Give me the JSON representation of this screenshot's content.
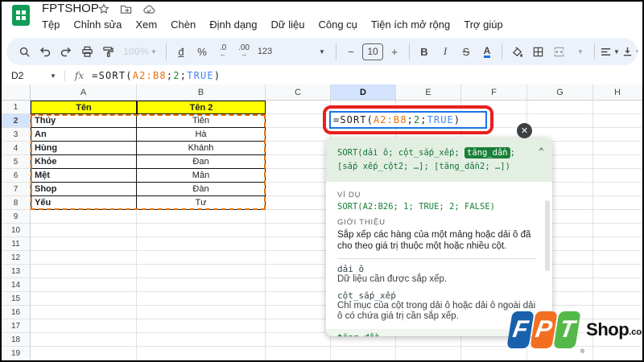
{
  "window": {
    "title": "FPTSHOP"
  },
  "menu_bar": {
    "items": [
      "Tệp",
      "Chỉnh sửa",
      "Xem",
      "Chèn",
      "Định dạng",
      "Dữ liệu",
      "Công cụ",
      "Tiện ích mở rộng",
      "Trợ giúp"
    ]
  },
  "toolbar": {
    "zoom_value": "100%",
    "currency_label": "đ",
    "percent_label": "%",
    "decimal_decrease_label": ".0",
    "decimal_increase_label": ".00",
    "number_format_label": "123",
    "font_size_value": "10",
    "minus_label": "−",
    "plus_label": "+",
    "bold_label": "B",
    "italic_label": "I",
    "strikethrough_label": "S",
    "text_color_label": "A"
  },
  "formula_bar": {
    "cell_reference": "D2",
    "fx_label": "fx",
    "formula_parts": [
      {
        "text": "=SORT(",
        "color": "#202124"
      },
      {
        "text": "A2:B8",
        "color": "#e8710a"
      },
      {
        "text": ";",
        "color": "#202124"
      },
      {
        "text": "2",
        "color": "#188038"
      },
      {
        "text": ";",
        "color": "#202124"
      },
      {
        "text": "TRUE",
        "color": "#4285f4"
      },
      {
        "text": ")",
        "color": "#202124"
      }
    ]
  },
  "grid": {
    "column_headers": [
      "A",
      "B",
      "C",
      "D",
      "E",
      "F",
      "G",
      "H"
    ],
    "row_headers": [
      "1",
      "2",
      "3",
      "4",
      "5",
      "6",
      "7",
      "8",
      "9",
      "10",
      "11",
      "12",
      "13",
      "14",
      "15",
      "16",
      "17",
      "18",
      "19"
    ],
    "selected_column": "D",
    "selected_row": "2",
    "table": {
      "header_row": [
        "Tên",
        "Tên 2"
      ],
      "data_rows": [
        [
          "Thúy",
          "Tiên"
        ],
        [
          "An",
          "Hà"
        ],
        [
          "Hùng",
          "Khánh"
        ],
        [
          "Khỏe",
          "Đan"
        ],
        [
          "Mệt",
          "Mân"
        ],
        [
          "Shop",
          "Đàn"
        ],
        [
          "Yếu",
          "Tư"
        ]
      ]
    },
    "active_cell_formula_parts": [
      {
        "text": "=SORT(",
        "color": "#202124"
      },
      {
        "text": "A2:B8",
        "color": "#e8710a"
      },
      {
        "text": ";",
        "color": "#202124"
      },
      {
        "text": "2",
        "color": "#188038"
      },
      {
        "text": ";",
        "color": "#202124"
      },
      {
        "text": "TRUE",
        "color": "#4285f4"
      },
      {
        "text": ")",
        "color": "#202124"
      }
    ]
  },
  "formula_help": {
    "close_label": "✕",
    "collapse_label": "⌃",
    "syntax_prefix": "SORT(dải ô; cột_sắp_xếp; ",
    "syntax_highlight": "tăng_dần",
    "syntax_suffix": ";",
    "syntax_line2": "[sắp xếp_cột2; …]; [tăng_dần2; …])",
    "example_label": "VÍ DỤ",
    "example_code": "SORT(A2:B26; 1; TRUE; 2; FALSE)",
    "about_label": "GIỚI THIỆU",
    "about_text": "Sắp xếp các hàng của một mảng hoặc dải ô đã cho theo giá trị thuộc một hoặc nhiều cột.",
    "arguments": [
      {
        "name": "dải ô",
        "description": "Dữ liệu cần được sắp xếp."
      },
      {
        "name": "cột_sắp_xếp",
        "description": "Chỉ mục của cột trong dải ô hoặc dải ô ngoài dải ô có chứa giá trị cần sắp xếp."
      },
      {
        "name": "tăng_dần",
        "description": ""
      }
    ]
  },
  "watermark": {
    "letters": [
      {
        "char": "F",
        "color": "#1961ac"
      },
      {
        "char": "P",
        "color": "#f26f21"
      },
      {
        "char": "T",
        "color": "#54b948"
      }
    ],
    "registered_mark": "®",
    "shop_text": "Shop",
    "domain_text": ".com.vn"
  },
  "colors": {
    "selection_blue": "#d3e3fd",
    "range_highlight_orange": "#e8710a",
    "table_header_yellow": "#ffff00",
    "annotation_red": "#e8201f",
    "help_green": "#188038",
    "sheets_green": "#0f9d58"
  }
}
